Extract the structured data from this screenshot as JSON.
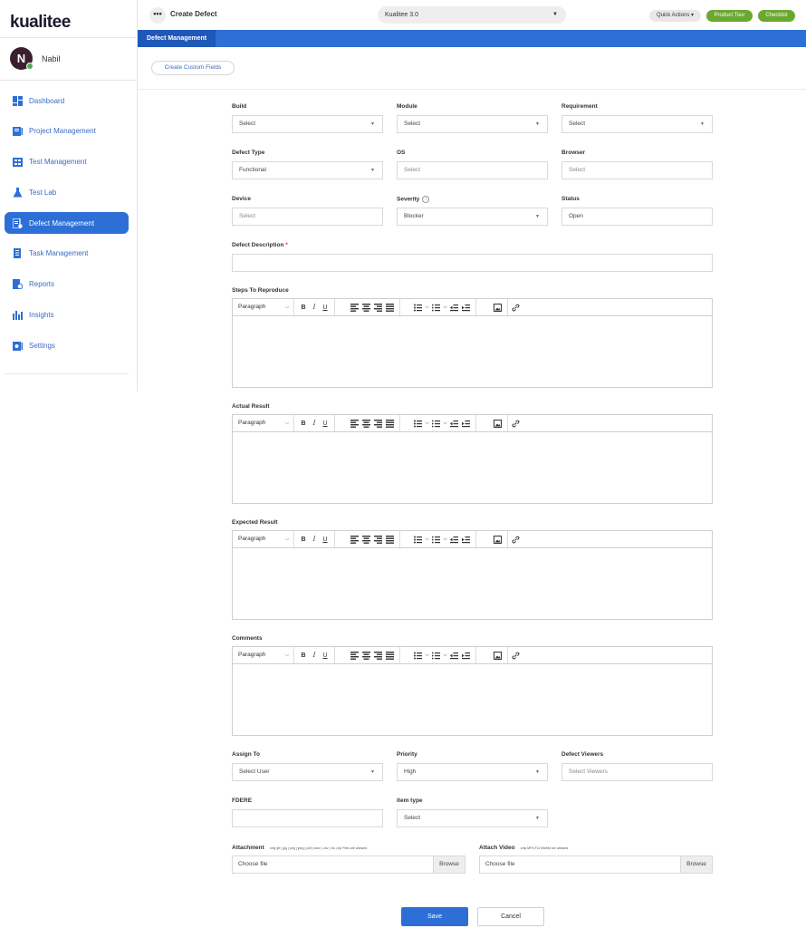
{
  "app": {
    "logo": "kualitee",
    "user_initial": "N",
    "user_name": "Nabil"
  },
  "sidebar": {
    "items": [
      {
        "label": "Dashboard",
        "icon": "dashboard-icon"
      },
      {
        "label": "Project Management",
        "icon": "project-icon"
      },
      {
        "label": "Test Management",
        "icon": "test-management-icon"
      },
      {
        "label": "Test Lab",
        "icon": "flask-icon"
      },
      {
        "label": "Defect Management",
        "icon": "defect-icon",
        "active": true
      },
      {
        "label": "Task Management",
        "icon": "task-icon"
      },
      {
        "label": "Reports",
        "icon": "reports-icon"
      },
      {
        "label": "Insights",
        "icon": "insights-icon"
      },
      {
        "label": "Settings",
        "icon": "settings-icon"
      }
    ]
  },
  "header": {
    "dots": "•••",
    "title": "Create Defect",
    "project": "Kualitee 3.0",
    "quick_actions": "Quick Actions",
    "product_tour": "Product Tour",
    "checklist": "Checklist"
  },
  "band": {
    "tab": "Defect Management"
  },
  "custom_fields_button": "Create Custom Fields",
  "form": {
    "build": {
      "label": "Build",
      "value": "Select"
    },
    "module": {
      "label": "Module",
      "value": "Select"
    },
    "requirement": {
      "label": "Requirement",
      "value": "Select"
    },
    "defect_type": {
      "label": "Defect Type",
      "value": "Functional"
    },
    "os": {
      "label": "OS",
      "placeholder": "Select"
    },
    "browser": {
      "label": "Browser",
      "placeholder": "Select"
    },
    "device": {
      "label": "Device",
      "placeholder": "Select"
    },
    "severity": {
      "label": "Severity",
      "value": "Blocker",
      "info": "i"
    },
    "status": {
      "label": "Status",
      "value": "Open"
    },
    "description": {
      "label": "Defect Description",
      "required": "*"
    },
    "steps": {
      "label": "Steps To Reproduce"
    },
    "actual": {
      "label": "Actual Result"
    },
    "expected": {
      "label": "Expected Result"
    },
    "comments": {
      "label": "Comments"
    },
    "editor_paragraph": "Paragraph",
    "assign_to": {
      "label": "Assign To",
      "value": "Select User"
    },
    "priority": {
      "label": "Priority",
      "value": "High"
    },
    "viewers": {
      "label": "Defect Viewers",
      "placeholder": "Select Viewers"
    },
    "fdere": {
      "label": "FDERE"
    },
    "item_type": {
      "label": "item type",
      "value": "Select"
    },
    "attachment": {
      "label": "Attachment",
      "hint": "only gif | jpg | png | jpeg | pdf | docx | csv | xls | zip Files are allowed",
      "file": "Choose file",
      "browse": "Browse"
    },
    "video": {
      "label": "Attach Video",
      "hint": "only MP4,FLV,WebM are allowed.",
      "file": "Choose file",
      "browse": "Browse"
    }
  },
  "actions": {
    "save": "Save",
    "cancel": "Cancel"
  }
}
